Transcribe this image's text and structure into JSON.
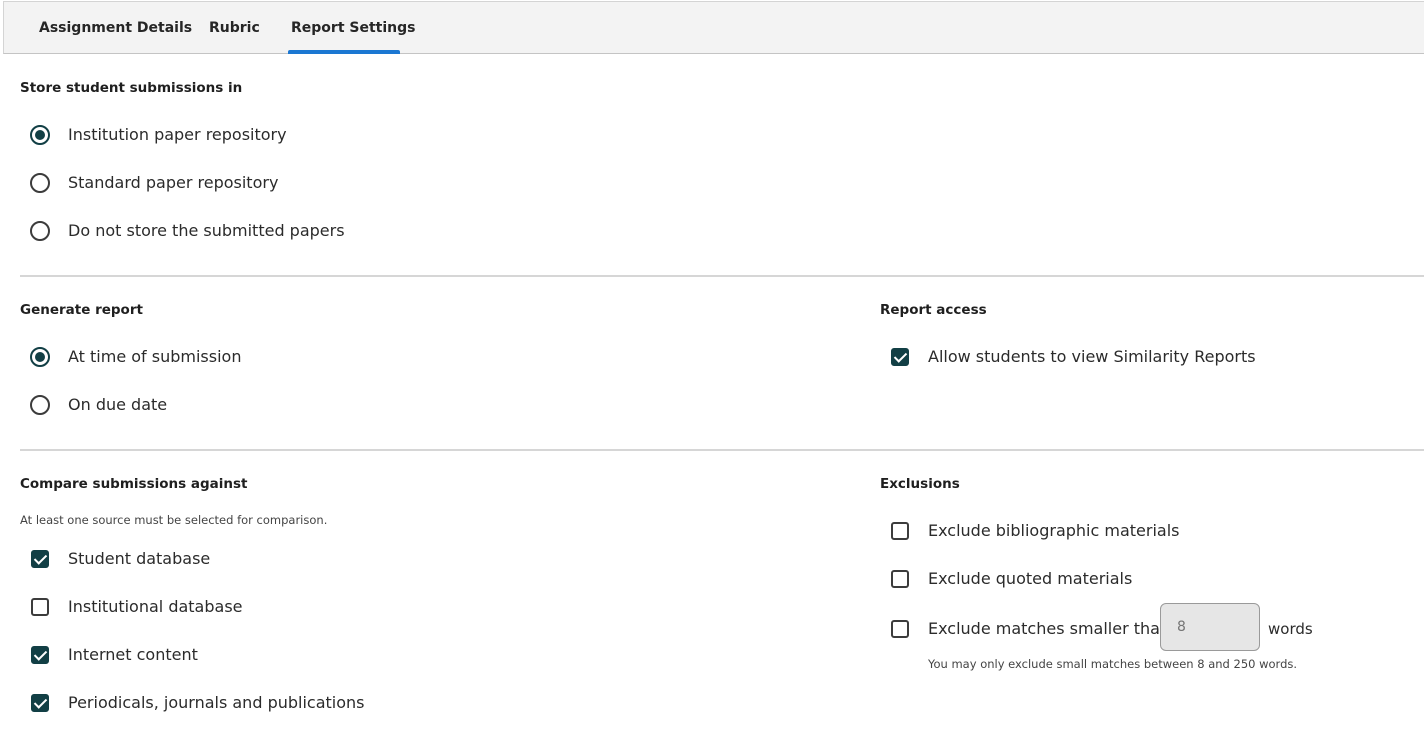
{
  "tabs": [
    {
      "label": "Assignment Details",
      "active": false
    },
    {
      "label": "Rubric",
      "active": false
    },
    {
      "label": "Report Settings",
      "active": true
    }
  ],
  "storage": {
    "heading": "Store student submissions in",
    "options": [
      {
        "label": "Institution paper repository",
        "selected": true
      },
      {
        "label": "Standard paper repository",
        "selected": false
      },
      {
        "label": "Do not store the submitted papers",
        "selected": false
      }
    ]
  },
  "generate_report": {
    "heading": "Generate report",
    "options": [
      {
        "label": "At time of submission",
        "selected": true
      },
      {
        "label": "On due date",
        "selected": false
      }
    ]
  },
  "report_access": {
    "heading": "Report access",
    "options": [
      {
        "label": "Allow students to view Similarity Reports",
        "checked": true
      }
    ]
  },
  "compare": {
    "heading": "Compare submissions against",
    "hint": "At least one source must be selected for comparison.",
    "options": [
      {
        "label": "Student database",
        "checked": true
      },
      {
        "label": "Institutional database",
        "checked": false
      },
      {
        "label": "Internet content",
        "checked": true
      },
      {
        "label": "Periodicals, journals and publications",
        "checked": true
      }
    ]
  },
  "exclusions": {
    "heading": "Exclusions",
    "options": [
      {
        "label": "Exclude bibliographic materials",
        "checked": false
      },
      {
        "label": "Exclude quoted materials",
        "checked": false
      },
      {
        "label": "Exclude matches smaller than",
        "checked": false
      }
    ],
    "min_words_placeholder": "8",
    "words_label": "words",
    "hint": "You may only exclude small matches between 8 and 250 words."
  },
  "colors": {
    "accent_blue": "#1b77d2",
    "control_dark_teal": "#123f45"
  }
}
